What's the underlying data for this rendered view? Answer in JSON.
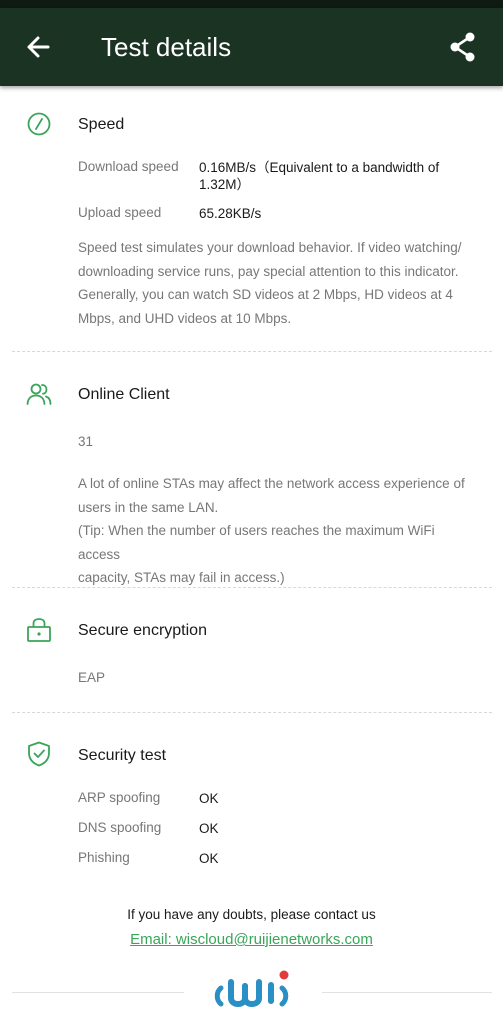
{
  "header": {
    "title": "Test details",
    "back_icon": "arrow-left-icon",
    "share_icon": "share-icon",
    "background": "#1b3322"
  },
  "accent_color": "#3aa55a",
  "speed": {
    "icon": "speedometer-icon",
    "title": "Speed",
    "download_label": "Download speed",
    "download_value_line1": "0.16MB/s（Equivalent to a bandwidth of",
    "download_value_line2": "1.32M）",
    "upload_label": "Upload speed",
    "upload_value": "65.28KB/s",
    "description": [
      "Speed test simulates your download behavior. If video watching/",
      "downloading service runs, pay special attention to this indicator.",
      "Generally, you can watch SD videos at 2 Mbps, HD videos at 4",
      "Mbps, and UHD videos at 10 Mbps."
    ]
  },
  "online_client": {
    "icon": "users-icon",
    "title": "Online Client",
    "value": "31",
    "description": [
      "A lot of online STAs may affect the network access experience of",
      "users in the same LAN.",
      "(Tip: When the number of users reaches the maximum WiFi access",
      "capacity, STAs may fail in access.)"
    ]
  },
  "encryption": {
    "icon": "lock-icon",
    "title": "Secure encryption",
    "value": "EAP"
  },
  "security_test": {
    "icon": "shield-check-icon",
    "title": "Security test",
    "items": [
      {
        "label": "ARP spoofing",
        "value": "OK"
      },
      {
        "label": "DNS spoofing",
        "value": "OK"
      },
      {
        "label": "Phishing",
        "value": "OK"
      }
    ]
  },
  "contact": {
    "text": "If you have any doubts, please contact us",
    "email_link": "Email: wiscloud@ruijienetworks.com"
  },
  "footer": {
    "logo_icon": "wiscloud-logo-icon"
  }
}
